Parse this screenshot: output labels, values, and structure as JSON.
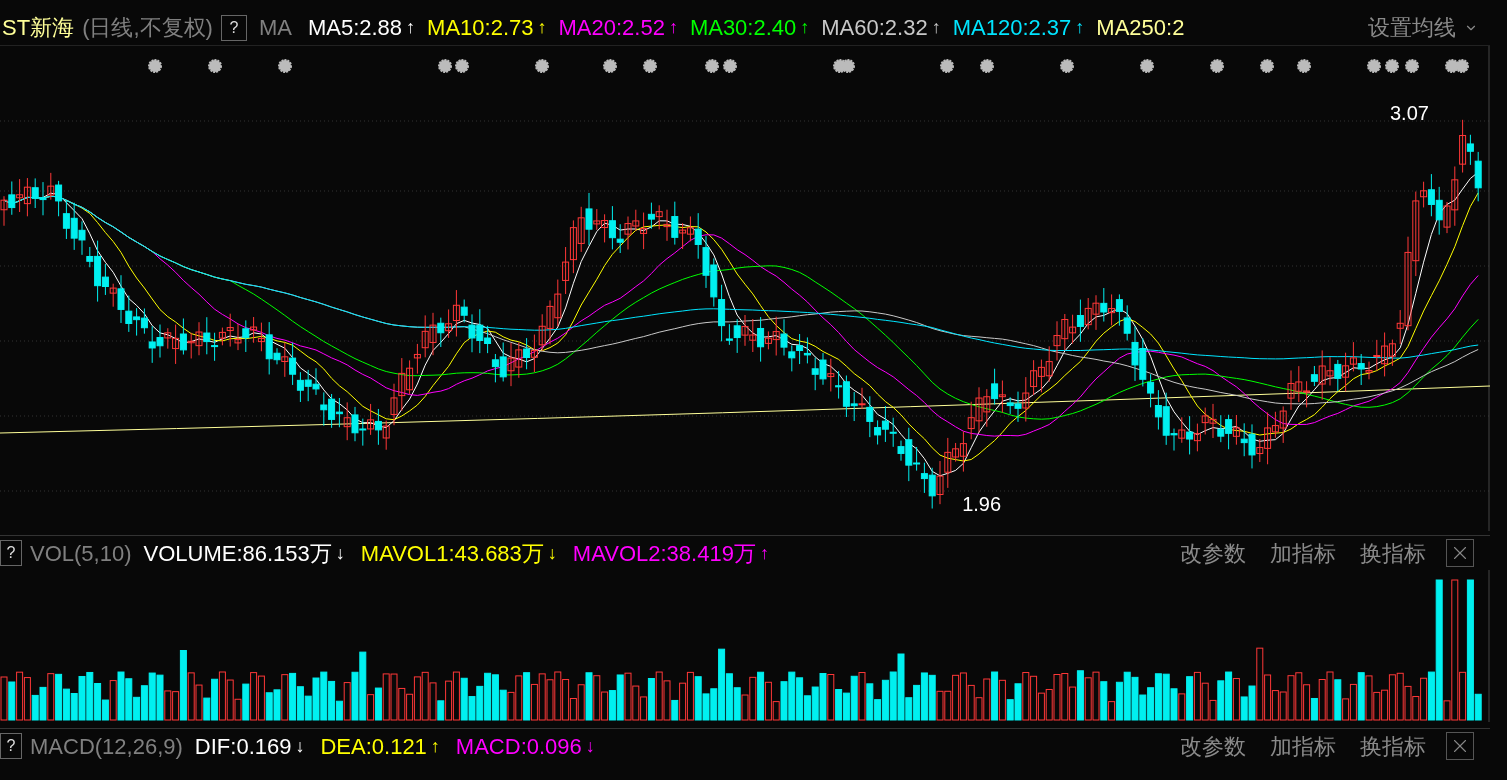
{
  "main": {
    "stock": "ST新海",
    "period": "(日线,不复权)",
    "help": "?",
    "indicator": "MA",
    "lines": [
      {
        "label": "MA5:2.88",
        "arrow": "↑",
        "color": "#ffffff"
      },
      {
        "label": "MA10:2.73",
        "arrow": "↑",
        "color": "#ffff00"
      },
      {
        "label": "MA20:2.52",
        "arrow": "↑",
        "color": "#ff00ff"
      },
      {
        "label": "MA30:2.40",
        "arrow": "↑",
        "color": "#00ff00"
      },
      {
        "label": "MA60:2.32",
        "arrow": "↑",
        "color": "#c8c8c8"
      },
      {
        "label": "MA120:2.37",
        "arrow": "↑",
        "color": "#00e5ff"
      },
      {
        "label": "MA250:2",
        "color": "#ffff99"
      }
    ],
    "menu": "设置均线",
    "high_label": "3.07",
    "low_label": "1.96"
  },
  "volume_panel": {
    "help": "?",
    "indicator": "VOL(5,10)",
    "lines": [
      {
        "label": "VOLUME:86.153万",
        "arrow": "↓",
        "color": "#ffffff"
      },
      {
        "label": "MAVOL1:43.683万",
        "arrow": "↓",
        "color": "#ffff00"
      },
      {
        "label": "MAVOL2:38.419万",
        "arrow": "↑",
        "color": "#ff00ff"
      }
    ],
    "actions": [
      "改参数",
      "加指标",
      "换指标"
    ]
  },
  "macd_panel": {
    "help": "?",
    "indicator": "MACD(12,26,9)",
    "lines": [
      {
        "label": "DIF:0.169",
        "arrow": "↓",
        "color": "#ffffff"
      },
      {
        "label": "DEA:0.121",
        "arrow": "↑",
        "color": "#ffff00"
      },
      {
        "label": "MACD:0.096",
        "arrow": "↓",
        "color": "#ff00ff"
      }
    ],
    "actions": [
      "改参数",
      "加指标",
      "换指标"
    ]
  }
}
